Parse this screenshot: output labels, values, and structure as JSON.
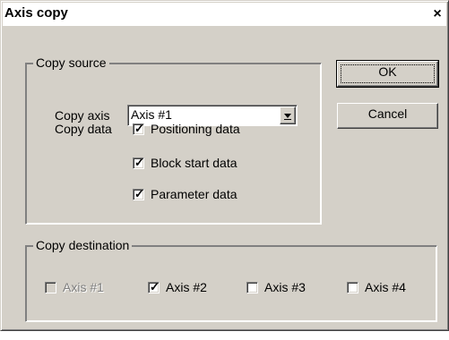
{
  "dialog": {
    "title": "Axis copy",
    "close_glyph": "×"
  },
  "copy_source": {
    "legend": "Copy source",
    "copy_axis_label": "Copy axis",
    "copy_axis_value": "Axis #1",
    "copy_data_label": "Copy data",
    "options": [
      {
        "label": "Positioning data",
        "checked": true
      },
      {
        "label": "Block start data",
        "checked": true
      },
      {
        "label": "Parameter data",
        "checked": true
      }
    ]
  },
  "buttons": {
    "ok": "OK",
    "cancel": "Cancel"
  },
  "copy_destination": {
    "legend": "Copy destination",
    "axes": [
      {
        "label": "Axis #1",
        "checked": false,
        "disabled": true
      },
      {
        "label": "Axis #2",
        "checked": true,
        "disabled": false
      },
      {
        "label": "Axis #3",
        "checked": false,
        "disabled": false
      },
      {
        "label": "Axis #4",
        "checked": false,
        "disabled": false
      }
    ]
  },
  "check_glyph": "✓",
  "colors": {
    "face": "#d4d0c8",
    "disabled_text": "#808080"
  }
}
